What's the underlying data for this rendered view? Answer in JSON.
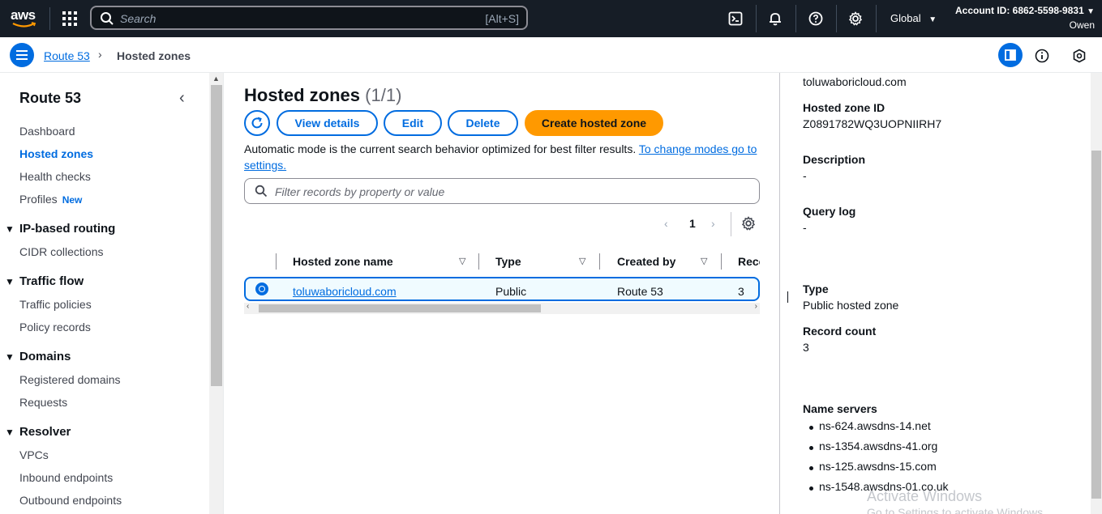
{
  "topbar": {
    "logo": "aws",
    "search_placeholder": "Search",
    "search_shortcut": "[Alt+S]",
    "region": "Global",
    "account_id": "Account ID: 6862-5598-9831",
    "user": "Owen",
    "icons": [
      "services-grid-icon",
      "cloudshell-icon",
      "notifications-icon",
      "help-icon",
      "settings-icon"
    ]
  },
  "breadcrumb": {
    "parent": "Route 53",
    "separator": "›",
    "current": "Hosted zones"
  },
  "sidebar": {
    "title": "Route 53",
    "items": [
      {
        "label": "Dashboard",
        "active": false
      },
      {
        "label": "Hosted zones",
        "active": true
      },
      {
        "label": "Health checks",
        "active": false
      },
      {
        "label": "Profiles",
        "badge": "New",
        "active": false
      }
    ],
    "sections": [
      {
        "label": "IP-based routing",
        "items": [
          "CIDR collections"
        ]
      },
      {
        "label": "Traffic flow",
        "items": [
          "Traffic policies",
          "Policy records"
        ]
      },
      {
        "label": "Domains",
        "items": [
          "Registered domains",
          "Requests"
        ]
      },
      {
        "label": "Resolver",
        "items": [
          "VPCs",
          "Inbound endpoints",
          "Outbound endpoints"
        ]
      }
    ]
  },
  "main": {
    "title": "Hosted zones",
    "count": "(1/1)",
    "buttons": {
      "view_details": "View details",
      "edit": "Edit",
      "delete": "Delete",
      "create": "Create hosted zone"
    },
    "info_text": "Automatic mode is the current search behavior optimized for best filter results. ",
    "info_link": "To change modes go to settings.",
    "filter_placeholder": "Filter records by property or value",
    "page_number": "1",
    "table": {
      "columns": [
        "Hosted zone name",
        "Type",
        "Created by",
        "Reco"
      ],
      "rows": [
        {
          "name": "toluwaboricloud.com",
          "type": "Public",
          "created_by": "Route 53",
          "record_count": "3",
          "selected": true
        }
      ]
    }
  },
  "details": {
    "top_value": "toluwaboricloud.com",
    "hosted_zone_id_label": "Hosted zone ID",
    "hosted_zone_id": "Z0891782WQ3UOPNIIRH7",
    "description_label": "Description",
    "description": "-",
    "query_log_label": "Query log",
    "query_log": "-",
    "type_label": "Type",
    "type": "Public hosted zone",
    "record_count_label": "Record count",
    "record_count": "3",
    "name_servers_label": "Name servers",
    "name_servers": [
      "ns-624.awsdns-14.net",
      "ns-1354.awsdns-41.org",
      "ns-125.awsdns-15.com",
      "ns-1548.awsdns-01.co.uk"
    ]
  },
  "watermark": {
    "line1": "Activate Windows",
    "line2": "Go to Settings to activate Windows."
  },
  "colors": {
    "topbar_bg": "#161d26",
    "link_blue": "#006ce0",
    "primary_orange": "#ff9900"
  }
}
